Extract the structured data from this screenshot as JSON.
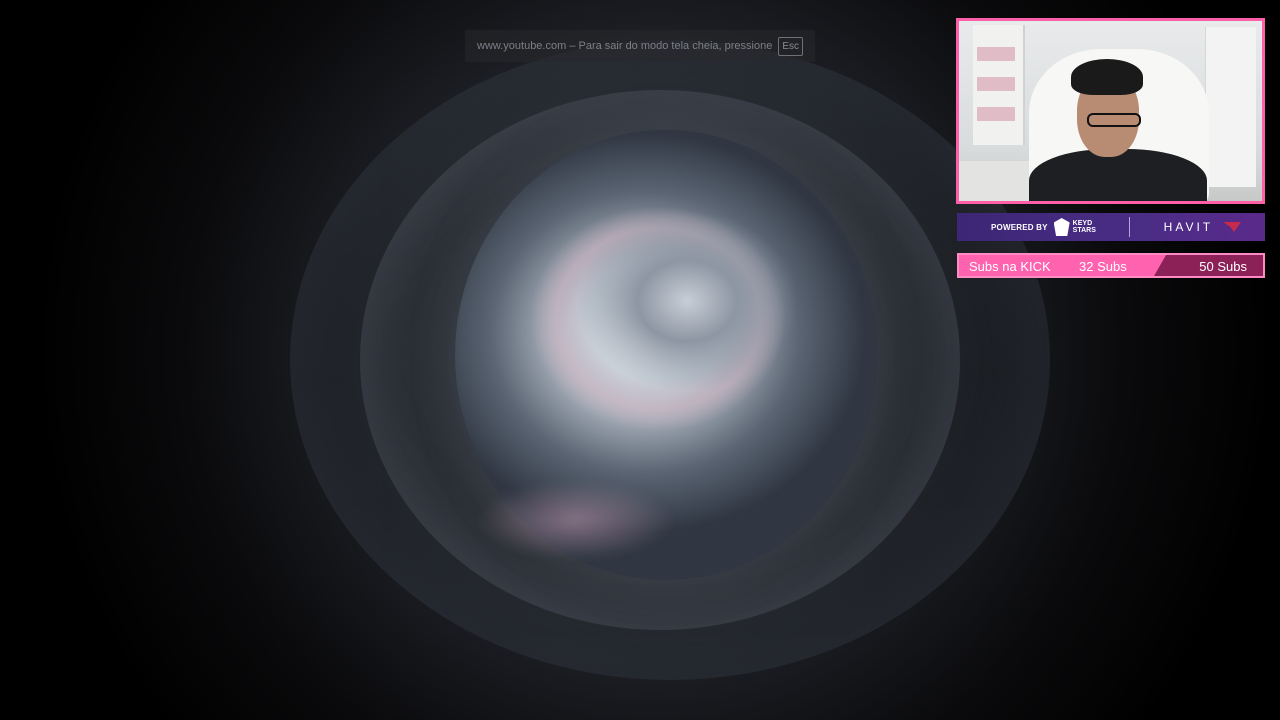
{
  "fullscreen_notice": {
    "text": "www.youtube.com – Para sair do modo tela cheia, pressione",
    "key": "Esc"
  },
  "sponsor": {
    "powered_by": "POWERED BY",
    "keyd_line1": "KEYD",
    "keyd_line2": "STARS",
    "havit": "HAVIT"
  },
  "subs_goal": {
    "label": "Subs na KICK",
    "current": "32 Subs",
    "goal": "50 Subs",
    "progress": 0.64
  },
  "colors": {
    "overlay_accent": "#ff63b0",
    "sponsor_bg": "#4a2d86",
    "subs_dark": "#8b2157",
    "background": "#000000"
  }
}
